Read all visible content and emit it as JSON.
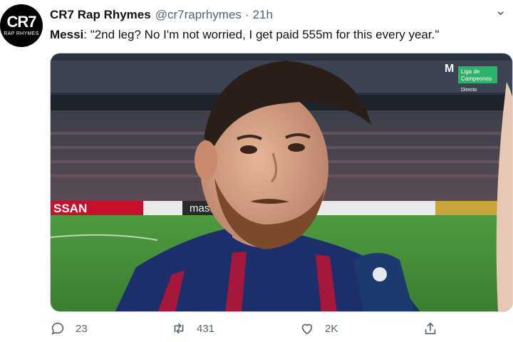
{
  "account": {
    "display_name": "CR7 Rap Rhymes",
    "handle": "@cr7raprhymes",
    "separator": "·",
    "time": "21h",
    "avatar_big": "CR7",
    "avatar_small": "RAP RHYMES"
  },
  "tweet": {
    "speaker": "Messi",
    "quote": ": \"2nd leg? No I'm not worried, I get paid 555m for this every year.\""
  },
  "media": {
    "broadcaster_logo": "M",
    "broadcast_label_line1": "Liga de",
    "broadcast_label_line2": "Campeones",
    "broadcast_status": "Directo",
    "board_text_left": "SSAN",
    "board_text_center": "mastercard"
  },
  "actions": {
    "reply_count": "23",
    "retweet_count": "431",
    "like_count": "2K"
  },
  "icons": {
    "reply": "reply-icon",
    "retweet": "retweet-icon",
    "like": "heart-icon",
    "share": "share-icon",
    "more": "more-icon"
  },
  "colors": {
    "text_primary": "#0f1419",
    "text_secondary": "#536471",
    "pitch_green": "#3f8a3a",
    "broadcast_green": "#2bb36a"
  }
}
